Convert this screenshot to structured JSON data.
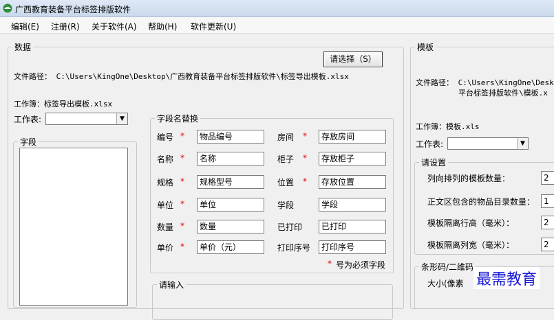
{
  "window": {
    "title": "广西教育装备平台标签排版软件"
  },
  "menu": [
    {
      "label": "编辑(E)"
    },
    {
      "label": "注册(R)"
    },
    {
      "label": "关于软件(A)"
    },
    {
      "label": "帮助(H)"
    },
    {
      "label": "软件更新(U)"
    }
  ],
  "data_group": {
    "legend": "数据",
    "select_button": "请选择（S）",
    "file_path": "文件路径： C:\\Users\\KingOne\\Desktop\\广西教育装备平台标签排版软件\\标签导出模板.xlsx",
    "workbook": "工作簿：标签导出模板.xlsx",
    "sheet_label": "工作表:",
    "sheet_value": "",
    "fields_legend": "字段"
  },
  "mapping": {
    "legend": "字段名替换",
    "rows": [
      {
        "left_label": "编号",
        "left_req": "*",
        "left_value": "物品编号",
        "right_label": "房间",
        "right_req": "*",
        "right_value": "存放房间"
      },
      {
        "left_label": "名称",
        "left_req": "*",
        "left_value": "名称",
        "right_label": "柜子",
        "right_req": "*",
        "right_value": "存放柜子"
      },
      {
        "left_label": "规格",
        "left_req": "*",
        "left_value": "规格型号",
        "right_label": "位置",
        "right_req": "*",
        "right_value": "存放位置"
      },
      {
        "left_label": "单位",
        "left_req": "*",
        "left_value": "单位",
        "right_label": "学段",
        "right_req": "",
        "right_value": "学段"
      },
      {
        "left_label": "数量",
        "left_req": "*",
        "left_value": "数量",
        "right_label": "已打印",
        "right_req": "",
        "right_value": "已打印"
      },
      {
        "left_label": "单价",
        "left_req": "*",
        "left_value": "单价（元）",
        "right_label": "打印序号",
        "right_req": "",
        "right_value": "打印序号"
      }
    ],
    "note_star": "*",
    "note_text": "号为必须字段"
  },
  "input_group": {
    "legend": "请输入"
  },
  "template_group": {
    "legend": "模板",
    "file_path_line1": "文件路径： C:\\Users\\KingOne\\Deskto",
    "file_path_line2": "平台标签排版软件\\模板.x",
    "workbook": "工作簿：模板.xls",
    "sheet_label": "工作表:",
    "sheet_value": "",
    "settings_legend": "请设置",
    "settings": [
      {
        "label": "列向排列的模板数量：",
        "value": "2"
      },
      {
        "label": "正文区包含的物品目录数量：",
        "value": "1"
      },
      {
        "label": "模板隔离行高（毫米）：",
        "value": "2"
      },
      {
        "label": "模板隔离列宽（毫米）：",
        "value": "2"
      }
    ],
    "barcode_legend": "条形码/二维码",
    "barcode_size_label": "大小(像素"
  },
  "watermark": "最需教育"
}
